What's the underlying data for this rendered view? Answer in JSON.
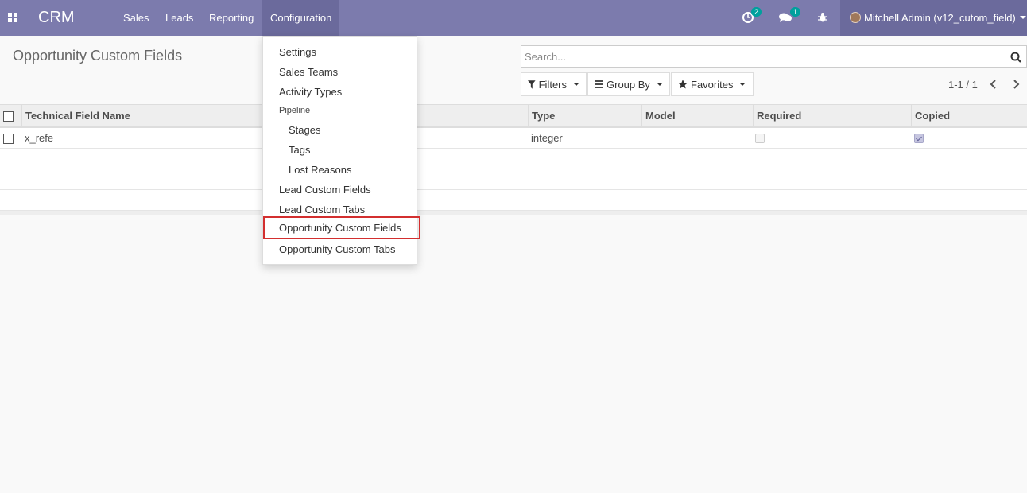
{
  "navbar": {
    "brand": "CRM",
    "menu": [
      "Sales",
      "Leads",
      "Reporting",
      "Configuration"
    ],
    "activity_count": "2",
    "message_count": "1",
    "user_name": "Mitchell Admin (v12_cutom_field)",
    "icons": [
      "apps-icon",
      "clock-icon",
      "chat-icon",
      "bug-icon",
      "avatar"
    ]
  },
  "control_panel": {
    "title": "Opportunity Custom Fields",
    "search_placeholder": "Search...",
    "filters_label": "Filters",
    "group_by_label": "Group By",
    "favorites_label": "Favorites",
    "pager": "1-1 / 1"
  },
  "table": {
    "headers": [
      "Technical Field Name",
      "Type",
      "Model",
      "Required",
      "Copied"
    ],
    "rows": [
      {
        "technical_field_name": "x_refe",
        "type": "integer",
        "model": "",
        "required": false,
        "copied": true
      }
    ]
  },
  "dropdown": {
    "items": {
      "settings": "Settings",
      "sales_teams": "Sales Teams",
      "activity_types": "Activity Types",
      "pipeline_header": "Pipeline",
      "stages": "Stages",
      "tags": "Tags",
      "lost_reasons": "Lost Reasons",
      "lead_custom_fields": "Lead Custom Fields",
      "lead_custom_tabs": "Lead Custom Tabs",
      "opportunity_custom_fields": "Opportunity Custom Fields",
      "opportunity_custom_tabs": "Opportunity Custom Tabs"
    }
  },
  "colors": {
    "navbar": "#7c7bad",
    "navbar_active": "#6b6a9c",
    "badge": "#00a09d",
    "highlight_border": "#d32f2f"
  }
}
